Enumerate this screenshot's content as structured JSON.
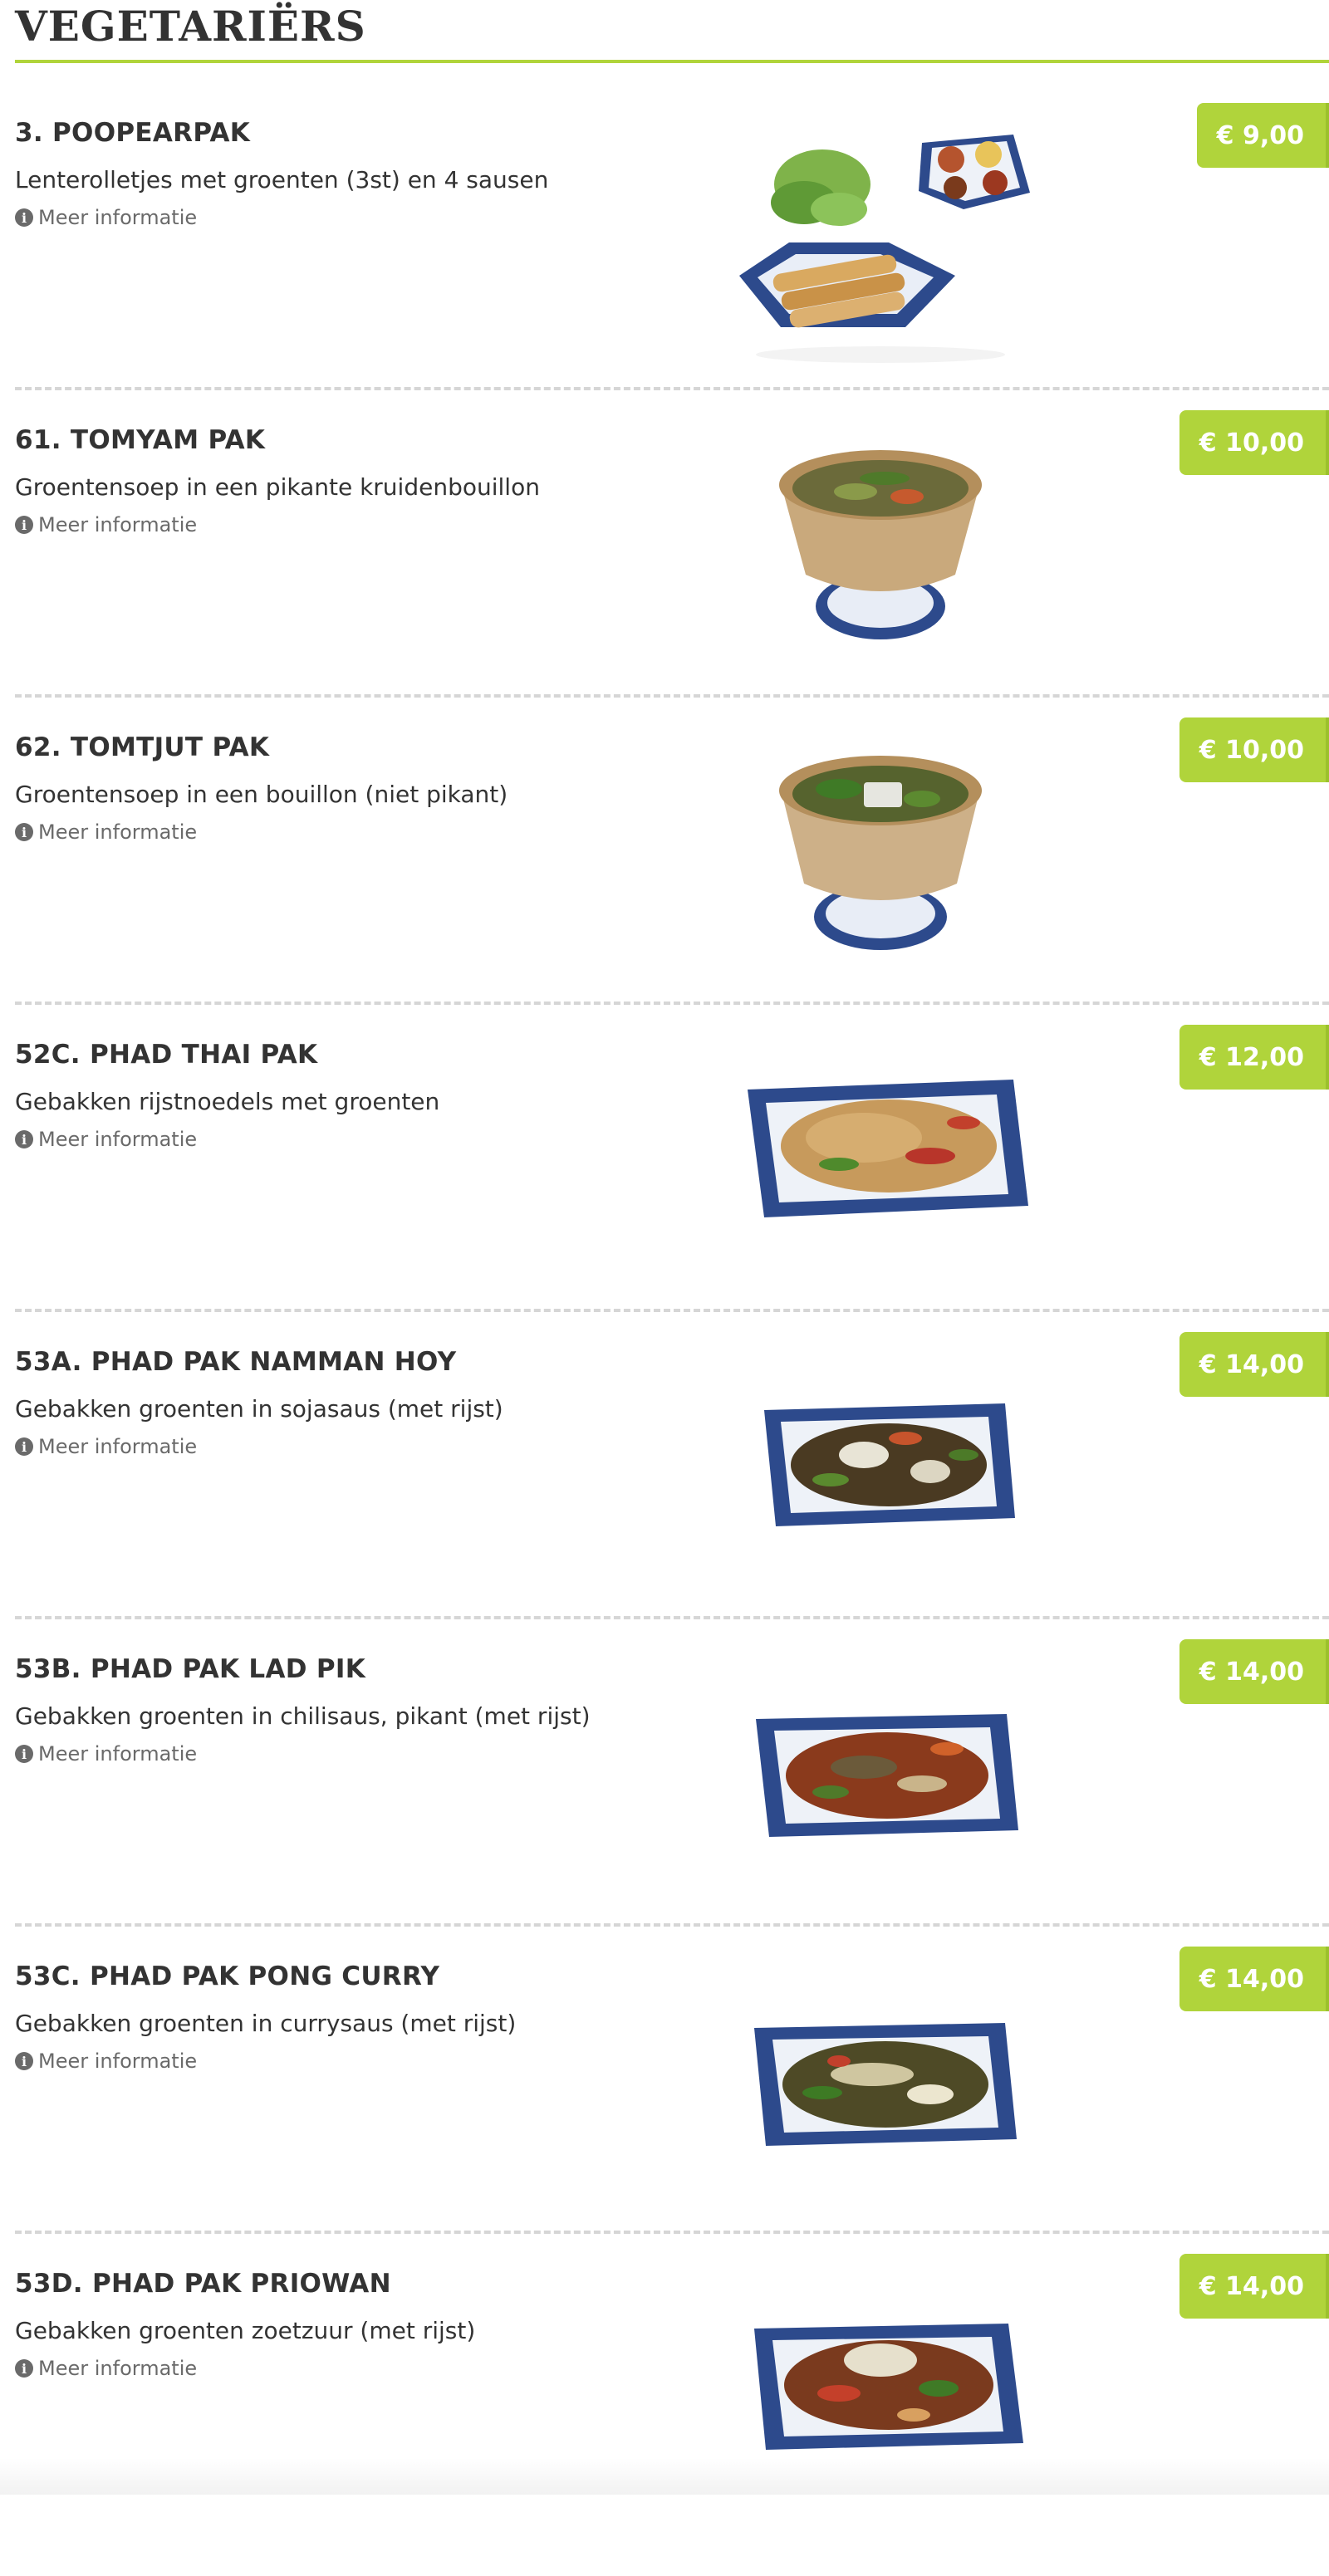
{
  "section": {
    "title": "VEGETARIËRS"
  },
  "info_label": "Meer informatie",
  "colors": {
    "accent": "#b0d43b",
    "text": "#333333",
    "muted": "#6a6a6a",
    "divider": "#d6d6d6"
  },
  "items": [
    {
      "title": "3. POOPEARPAK",
      "description": "Lenterolletjes met groenten (3st) en 4 sausen",
      "price": "€ 9,00",
      "photo": "spring-rolls-with-sauces"
    },
    {
      "title": "61. TOMYAM PAK",
      "description": "Groentensoep in een pikante kruidenbouillon",
      "price": "€ 10,00",
      "photo": "soup-bowl"
    },
    {
      "title": "62. TOMTJUT PAK",
      "description": "Groentensoep in een bouillon (niet pikant)",
      "price": "€ 10,00",
      "photo": "soup-bowl"
    },
    {
      "title": "52C. PHAD THAI PAK",
      "description": "Gebakken rijstnoedels met groenten",
      "price": "€ 12,00",
      "photo": "noodle-plate"
    },
    {
      "title": "53A. PHAD PAK NAMMAN HOY",
      "description": "Gebakken groenten in sojasaus (met rijst)",
      "price": "€ 14,00",
      "photo": "stir-fry-plate"
    },
    {
      "title": "53B. PHAD PAK LAD PIK",
      "description": "Gebakken groenten in chilisaus, pikant (met rijst)",
      "price": "€ 14,00",
      "photo": "stir-fry-plate"
    },
    {
      "title": "53C. PHAD PAK PONG CURRY",
      "description": "Gebakken groenten in currysaus (met rijst)",
      "price": "€ 14,00",
      "photo": "stir-fry-plate"
    },
    {
      "title": "53D. PHAD PAK PRIOWAN",
      "description": "Gebakken groenten zoetzuur (met rijst)",
      "price": "€ 14,00",
      "photo": "stir-fry-plate"
    }
  ]
}
